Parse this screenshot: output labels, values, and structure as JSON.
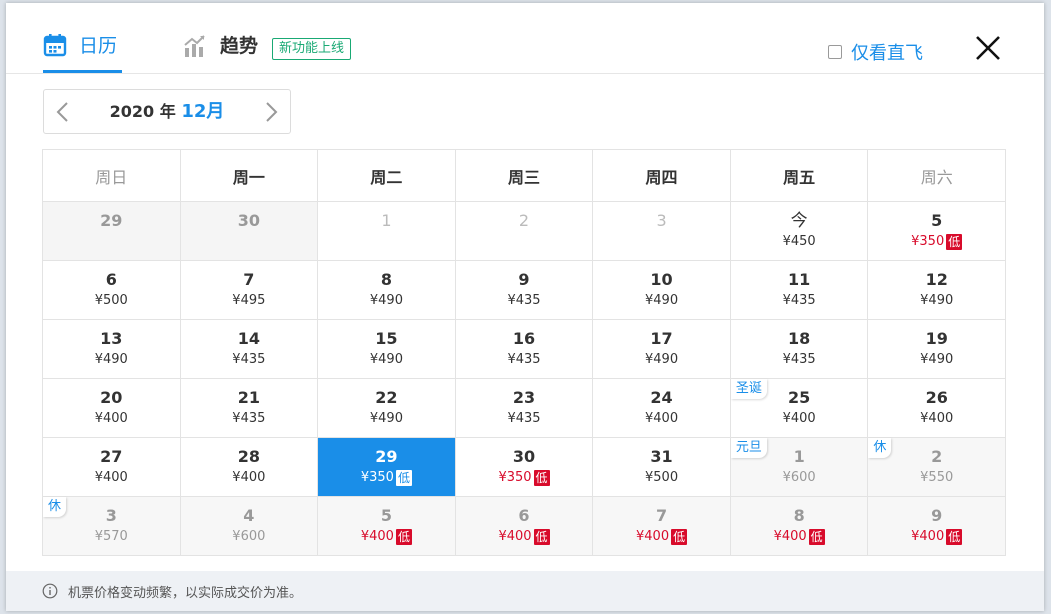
{
  "tabs": [
    {
      "label": "日历",
      "icon": "calendar-icon",
      "active": true
    },
    {
      "label": "趋势",
      "icon": "trend-chart-icon",
      "active": false
    }
  ],
  "new_badge": "新功能上线",
  "direct_only_label": "仅看直飞",
  "month_nav": {
    "year": "2020",
    "year_suffix": "年",
    "month": "12月"
  },
  "weekdays": [
    "周日",
    "周一",
    "周二",
    "周三",
    "周四",
    "周五",
    "周六"
  ],
  "weeks": [
    [
      {
        "day": "29",
        "price": "",
        "state": "past"
      },
      {
        "day": "30",
        "price": "",
        "state": "past"
      },
      {
        "day": "1",
        "price": "",
        "state": "dim"
      },
      {
        "day": "2",
        "price": "",
        "state": "dim"
      },
      {
        "day": "3",
        "price": "",
        "state": "dim"
      },
      {
        "day": "今",
        "price": "¥450",
        "state": "today"
      },
      {
        "day": "5",
        "price": "¥350",
        "state": "normal",
        "low": "低"
      }
    ],
    [
      {
        "day": "6",
        "price": "¥500",
        "state": "normal"
      },
      {
        "day": "7",
        "price": "¥495",
        "state": "normal"
      },
      {
        "day": "8",
        "price": "¥490",
        "state": "normal"
      },
      {
        "day": "9",
        "price": "¥435",
        "state": "normal"
      },
      {
        "day": "10",
        "price": "¥490",
        "state": "normal"
      },
      {
        "day": "11",
        "price": "¥435",
        "state": "normal"
      },
      {
        "day": "12",
        "price": "¥490",
        "state": "normal"
      }
    ],
    [
      {
        "day": "13",
        "price": "¥490",
        "state": "normal"
      },
      {
        "day": "14",
        "price": "¥435",
        "state": "normal"
      },
      {
        "day": "15",
        "price": "¥490",
        "state": "normal"
      },
      {
        "day": "16",
        "price": "¥435",
        "state": "normal"
      },
      {
        "day": "17",
        "price": "¥490",
        "state": "normal"
      },
      {
        "day": "18",
        "price": "¥435",
        "state": "normal"
      },
      {
        "day": "19",
        "price": "¥490",
        "state": "normal"
      }
    ],
    [
      {
        "day": "20",
        "price": "¥400",
        "state": "normal"
      },
      {
        "day": "21",
        "price": "¥435",
        "state": "normal"
      },
      {
        "day": "22",
        "price": "¥490",
        "state": "normal"
      },
      {
        "day": "23",
        "price": "¥435",
        "state": "normal"
      },
      {
        "day": "24",
        "price": "¥400",
        "state": "normal"
      },
      {
        "day": "25",
        "price": "¥400",
        "state": "normal",
        "tag": "圣诞"
      },
      {
        "day": "26",
        "price": "¥400",
        "state": "normal"
      }
    ],
    [
      {
        "day": "27",
        "price": "¥400",
        "state": "normal"
      },
      {
        "day": "28",
        "price": "¥400",
        "state": "normal"
      },
      {
        "day": "29",
        "price": "¥350",
        "state": "selected",
        "low": "低"
      },
      {
        "day": "30",
        "price": "¥350",
        "state": "normal",
        "low": "低"
      },
      {
        "day": "31",
        "price": "¥500",
        "state": "normal"
      },
      {
        "day": "1",
        "price": "¥600",
        "state": "next",
        "tag": "元旦"
      },
      {
        "day": "2",
        "price": "¥550",
        "state": "next",
        "tag": "休"
      }
    ],
    [
      {
        "day": "3",
        "price": "¥570",
        "state": "next",
        "tag": "休"
      },
      {
        "day": "4",
        "price": "¥600",
        "state": "next"
      },
      {
        "day": "5",
        "price": "¥400",
        "state": "next",
        "low": "低"
      },
      {
        "day": "6",
        "price": "¥400",
        "state": "next",
        "low": "低"
      },
      {
        "day": "7",
        "price": "¥400",
        "state": "next",
        "low": "低"
      },
      {
        "day": "8",
        "price": "¥400",
        "state": "next",
        "low": "低"
      },
      {
        "day": "9",
        "price": "¥400",
        "state": "next",
        "low": "低"
      }
    ]
  ],
  "footer_note": "机票价格变动频繁，以实际成交价为准。",
  "colors": {
    "accent": "#1a8ee8",
    "low_price": "#d80b2b",
    "new_badge": "#19a974"
  }
}
